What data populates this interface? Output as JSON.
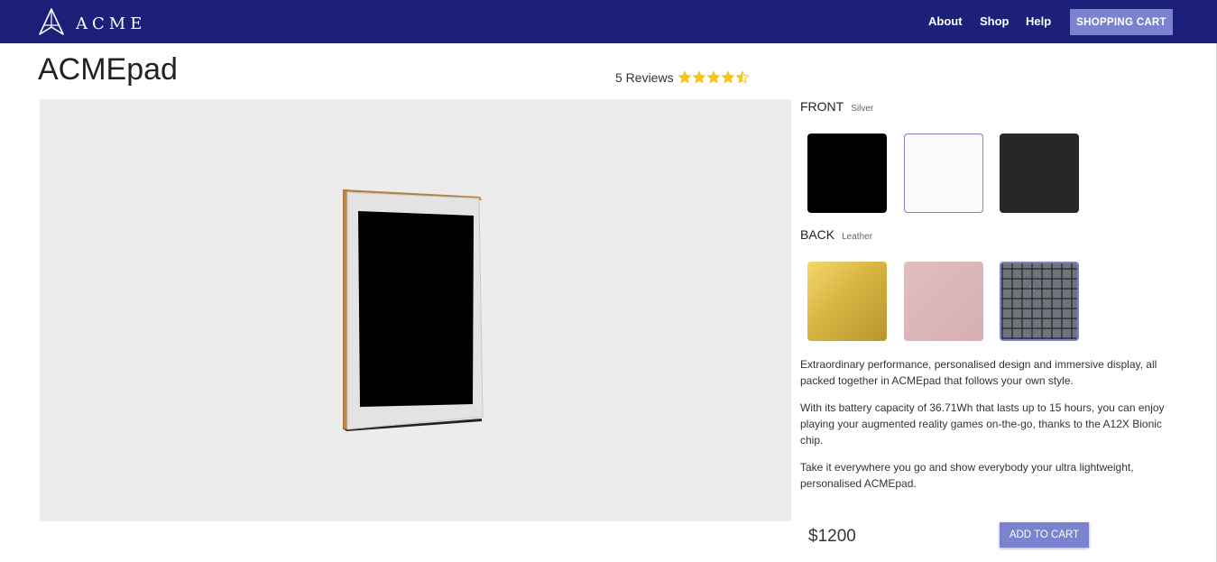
{
  "brand": {
    "name": "ACME",
    "logo_icon": "triangle-a-icon"
  },
  "nav": {
    "links": [
      "About",
      "Shop",
      "Help"
    ],
    "cart_label": "SHOPPING CART"
  },
  "product": {
    "title": "ACMEpad",
    "reviews_label": "5 Reviews",
    "rating": 4.5,
    "rating_max": 5,
    "star_color": "#f5c518",
    "price": "$1200",
    "add_to_cart_label": "ADD TO CART"
  },
  "options": {
    "front": {
      "label": "FRONT",
      "selected": "Silver",
      "swatches": [
        {
          "name": "black",
          "color": "#000000"
        },
        {
          "name": "silver",
          "color": "#fbfbfb",
          "selected": true
        },
        {
          "name": "space-gray",
          "color": "#27272a"
        }
      ]
    },
    "back": {
      "label": "BACK",
      "selected": "Leather",
      "swatches": [
        {
          "name": "gold",
          "color": "#d4b23f"
        },
        {
          "name": "rose",
          "color": "#dcb5b7"
        },
        {
          "name": "leather-plaid",
          "color": "#5f666c",
          "selected": true
        }
      ]
    }
  },
  "description": [
    "Extraordinary performance, personalised design and immersive display, all packed together in ACMEpad that follows your own style.",
    "With its battery capacity of 36.71Wh that lasts up to 15 hours, you can enjoy playing your augmented reality games on-the-go, thanks to the A12X Bionic chip.",
    "Take it everywhere you go and show everybody your ultra lightweight, personalised ACMEpad."
  ],
  "colors": {
    "navbar": "#1c2079",
    "accent_button": "#7b83d1",
    "selected_border": "#7b83d1"
  }
}
